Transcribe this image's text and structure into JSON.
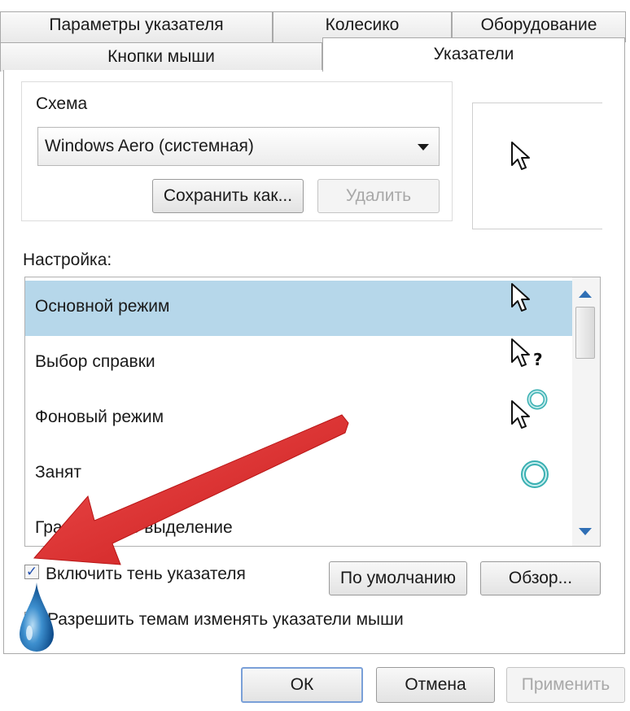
{
  "tabs": {
    "row1": [
      "Параметры указателя",
      "Колесико",
      "Оборудование"
    ],
    "row2": [
      "Кнопки мыши",
      "Указатели"
    ]
  },
  "scheme": {
    "label": "Схема",
    "selected": "Windows Aero (системная)",
    "save_as": "Сохранить как...",
    "delete": "Удалить"
  },
  "customize": {
    "label": "Настройка:",
    "items": [
      {
        "label": "Основной режим",
        "icon": "arrow-cursor-icon",
        "selected": true
      },
      {
        "label": "Выбор справки",
        "icon": "help-cursor-icon"
      },
      {
        "label": "Фоновый режим",
        "icon": "working-in-background-cursor-icon"
      },
      {
        "label": "Занят",
        "icon": "busy-cursor-icon"
      },
      {
        "label": "Графическое выделение",
        "icon": "precision-select-cursor-icon"
      }
    ]
  },
  "options": {
    "shadow_label": "Включить тень указателя",
    "shadow_checked": true,
    "themes_label": "Разрешить темам изменять указатели мыши",
    "themes_checked": false
  },
  "buttons": {
    "default": "По умолчанию",
    "browse": "Обзор...",
    "ok": "ОК",
    "cancel": "Отмена",
    "apply": "Применить"
  },
  "colors": {
    "selection": "#b6d7ea",
    "annotation_arrow": "#e12b2b"
  }
}
